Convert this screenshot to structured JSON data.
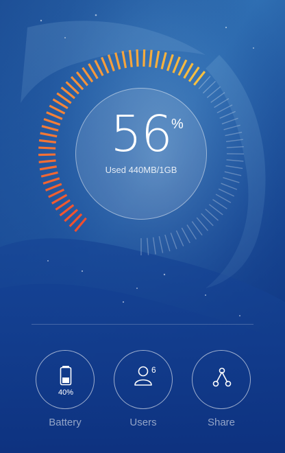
{
  "usage": {
    "percent": 56,
    "value_label": "56",
    "percent_sign": "%",
    "caption": "Used 440MB/1GB"
  },
  "gauge": {
    "active_fraction": 0.56,
    "colors": {
      "gradient_start": "#f04e2e",
      "gradient_mid": "#f58c3a",
      "gradient_end": "#f7c040",
      "inactive": "rgba(255,255,255,0.28)"
    }
  },
  "actions": [
    {
      "label": "Battery",
      "icon": "battery-icon",
      "value": "40%",
      "level": 0.4
    },
    {
      "label": "Users",
      "icon": "user-icon",
      "value": "6"
    },
    {
      "label": "Share",
      "icon": "share-icon"
    }
  ],
  "theme": {
    "wallpaper": "ocean-wave",
    "ring_color": "#ffffff"
  }
}
